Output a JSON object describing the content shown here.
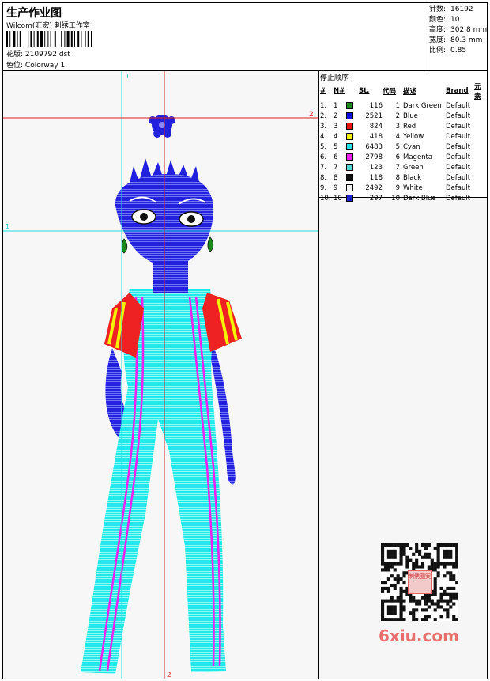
{
  "header": {
    "title": "生产作业图",
    "subtitle": "Wilcom(汇宏) 刺绣工作室",
    "design_file_label": "花版:",
    "design_file": "2109792.dst",
    "colorway_label": "色位:",
    "colorway": "Colorway 1"
  },
  "stats": {
    "stitches_label": "针数:",
    "stitches": "16192",
    "colors_label": "颜色:",
    "colors": "10",
    "height_label": "高度:",
    "height": "302.8 mm",
    "width_label": "宽度:",
    "width": "80.3 mm",
    "scale_label": "比例:",
    "scale": "0.85"
  },
  "guides": {
    "v1": "1",
    "v2": "2",
    "h1": "1",
    "h2": "2"
  },
  "stop_sequence": {
    "title": "停止顺序 :",
    "headers": [
      "#",
      "N#",
      "St.",
      "代码",
      "描述",
      "Brand",
      "元素"
    ],
    "rows": [
      {
        "num": "1.",
        "n": "1",
        "color": "#1a8a1a",
        "st": "116",
        "code": "1",
        "desc": "Dark Green",
        "brand": "Default"
      },
      {
        "num": "2.",
        "n": "2",
        "color": "#1212e0",
        "st": "2521",
        "code": "2",
        "desc": "Blue",
        "brand": "Default"
      },
      {
        "num": "3.",
        "n": "3",
        "color": "#ee1111",
        "st": "824",
        "code": "3",
        "desc": "Red",
        "brand": "Default"
      },
      {
        "num": "4.",
        "n": "4",
        "color": "#f4f400",
        "st": "418",
        "code": "4",
        "desc": "Yellow",
        "brand": "Default"
      },
      {
        "num": "5.",
        "n": "5",
        "color": "#22e6e6",
        "st": "6483",
        "code": "5",
        "desc": "Cyan",
        "brand": "Default"
      },
      {
        "num": "6.",
        "n": "6",
        "color": "#ee22ee",
        "st": "2798",
        "code": "6",
        "desc": "Magenta",
        "brand": "Default"
      },
      {
        "num": "7.",
        "n": "7",
        "color": "#55d6d0",
        "st": "123",
        "code": "7",
        "desc": "Green",
        "brand": "Default"
      },
      {
        "num": "8.",
        "n": "8",
        "color": "#111111",
        "st": "118",
        "code": "8",
        "desc": "Black",
        "brand": "Default"
      },
      {
        "num": "9.",
        "n": "9",
        "color": "#f2f2f2",
        "st": "2492",
        "code": "9",
        "desc": "White",
        "brand": "Default"
      },
      {
        "num": "10.",
        "n": "10",
        "color": "#1a22cc",
        "st": "297",
        "code": "10",
        "desc": "Dark Blue",
        "brand": "Default"
      }
    ]
  },
  "watermark": {
    "text": "6xiu.com",
    "qr_text": "刺绣图案"
  }
}
